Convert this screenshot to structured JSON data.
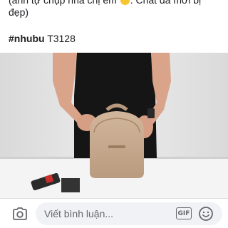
{
  "post": {
    "caption_line1": "(ảnh tự chụp nha chị em",
    "caption_line1_tail": ". Chất đã mơi bị",
    "caption_line2": "đẹp)",
    "hashtag": "#nhubu",
    "product_code": "T3128",
    "photo_alt": "woman-holding-backpack-photo"
  },
  "comment_bar": {
    "placeholder": "Viết bình luận...",
    "gif_label": "GIF"
  },
  "icons": {
    "camera": "camera-icon",
    "gif": "gif-icon",
    "emoji": "smiley-icon"
  },
  "colors": {
    "text": "#1c1e21",
    "placeholder": "#65676b",
    "input_bg": "#f0f2f5",
    "bag": "#c7ab90"
  }
}
